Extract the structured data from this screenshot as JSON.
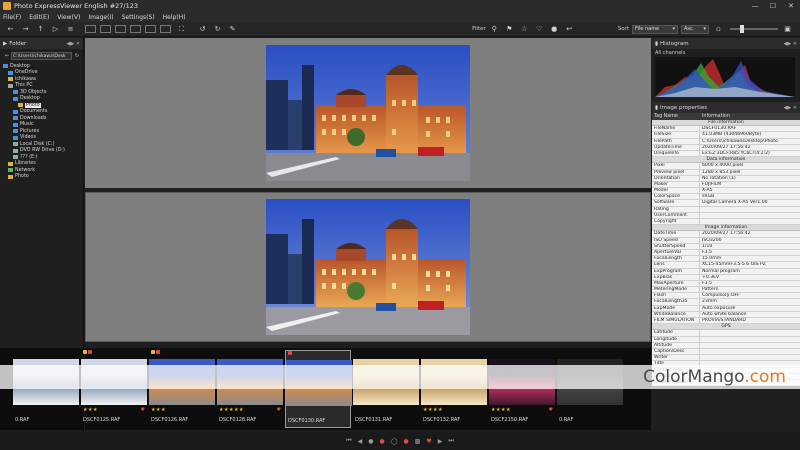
{
  "window": {
    "title": "Photo ExpressViewer English   #27/123",
    "minimize": "—",
    "maximize": "☐",
    "close": "✕"
  },
  "menu": [
    "File(F)",
    "Edit(E)",
    "View(V)",
    "Image(I)",
    "Settings(S)",
    "Help(H)"
  ],
  "toolbar": {
    "filter_label": "Filter",
    "sort_label": "Sort",
    "sort_field": "File name",
    "sort_order": "Asc."
  },
  "folder_panel": {
    "title": "Folder",
    "path": "C:\\Users\\ichikawa\\Desk",
    "tree": [
      {
        "label": "Desktop",
        "icon": "blue",
        "indent": 0
      },
      {
        "label": "OneDrive",
        "icon": "blue",
        "indent": 1
      },
      {
        "label": "ichikawa",
        "icon": "folder",
        "indent": 1
      },
      {
        "label": "This PC",
        "icon": "drive",
        "indent": 1
      },
      {
        "label": "3D Objects",
        "icon": "blue",
        "indent": 2
      },
      {
        "label": "Desktop",
        "icon": "blue",
        "indent": 2
      },
      {
        "label": "Photo",
        "icon": "folder",
        "indent": 3,
        "selected": true
      },
      {
        "label": "Documents",
        "icon": "blue",
        "indent": 2
      },
      {
        "label": "Downloads",
        "icon": "blue",
        "indent": 2
      },
      {
        "label": "Music",
        "icon": "blue",
        "indent": 2
      },
      {
        "label": "Pictures",
        "icon": "blue",
        "indent": 2
      },
      {
        "label": "Videos",
        "icon": "blue",
        "indent": 2
      },
      {
        "label": "Local Disk (C:)",
        "icon": "drive",
        "indent": 2
      },
      {
        "label": "DVD RW Drive (D:)",
        "icon": "drive",
        "indent": 2
      },
      {
        "label": "??? (E:)",
        "icon": "drive",
        "indent": 2
      },
      {
        "label": "Libraries",
        "icon": "folder",
        "indent": 1
      },
      {
        "label": "Network",
        "icon": "green",
        "indent": 1
      },
      {
        "label": "Photo",
        "icon": "folder",
        "indent": 1
      }
    ]
  },
  "histogram": {
    "title": "Histogram",
    "channel": "All channels"
  },
  "properties": {
    "title": "Image properties",
    "col_tag": "Tag Name",
    "col_info": "Information",
    "sections": [
      {
        "name": "File information",
        "rows": [
          [
            "FileName",
            "DSCF0130.RAF"
          ],
          [
            "FileSize",
            "41.03MB (43046960Byte)"
          ],
          [
            "FilePath",
            "C:\\Users\\ichikawa\\Desktop\\Photo"
          ],
          [
            "UpdateTime",
            "2020/09/27 17:56:42"
          ],
          [
            "UniqueInfo",
            "Ex:E2:3DCF:R85:YCbCr(4:2:2)"
          ]
        ]
      },
      {
        "name": "Data information",
        "rows": [
          [
            "Pixel",
            "6000 x 4000 pixel"
          ],
          [
            "Preview pixel",
            "1280 x 853 pixel"
          ],
          [
            "Orientation",
            "No rotation (1)"
          ],
          [
            "Maker",
            "FUJIFILM"
          ],
          [
            "Model",
            "X-A5"
          ],
          [
            "ColorSpace",
            "sRGB"
          ],
          [
            "Software",
            "Digital Camera X-A5 Ver1.00"
          ],
          [
            "Rating",
            ""
          ],
          [
            "UserComment",
            ""
          ],
          [
            "Copyright",
            ""
          ]
        ]
      },
      {
        "name": "Image information",
        "rows": [
          [
            "DateTime",
            "2020/09/27 17:56:42"
          ],
          [
            "ISO Speed",
            "ISO3200"
          ],
          [
            "ShutterSpeed",
            "1/10"
          ],
          [
            "ApertureVal",
            "F3.5"
          ],
          [
            "FocalLength",
            "15.0mm"
          ],
          [
            "Lens",
            "XC15-45mmF3.5-5.6 OIS PZ"
          ],
          [
            "ExpProgram",
            "Normal program"
          ],
          [
            "ExpBias",
            "+0.3EV"
          ],
          [
            "MaxAperture",
            "F3.5"
          ],
          [
            "MeteringMode",
            "Pattern"
          ],
          [
            "Flash",
            "Compulsory OFF"
          ],
          [
            "FocalLength35",
            "23mm"
          ],
          [
            "ExpMode",
            "Auto exposure"
          ],
          [
            "WhiteBalance",
            "Auto white balance"
          ],
          [
            "FILM SIMULATION",
            "PROVIA/STANDARD"
          ]
        ]
      },
      {
        "name": "GPS",
        "rows": [
          [
            "Latitude",
            ""
          ],
          [
            "Longitude",
            ""
          ],
          [
            "Altitude",
            ""
          ]
        ]
      },
      {
        "name": "",
        "rows": [
          [
            "Caption/Desc",
            ""
          ],
          [
            "Writer",
            ""
          ],
          [
            "Title",
            ""
          ],
          [
            "Contact info",
            ""
          ],
          [
            "Creator",
            ""
          ],
          [
            "Creator's Jobtit",
            ""
          ]
        ]
      }
    ]
  },
  "thumbnails": [
    {
      "name": "0.RAF",
      "stars": "",
      "heart": false,
      "badges": [],
      "style": "snow"
    },
    {
      "name": "DSCF0125.RAF",
      "stars": "★★★",
      "heart": true,
      "badges": [
        "y",
        "r"
      ],
      "style": "snow"
    },
    {
      "name": "DSCF0126.RAF",
      "stars": "★★★",
      "heart": false,
      "badges": [
        "y",
        "r"
      ],
      "style": "station"
    },
    {
      "name": "DSCF0128.RAF",
      "stars": "★★★★★",
      "heart": true,
      "badges": [],
      "style": "station"
    },
    {
      "name": "DSCF0130.RAF",
      "stars": "",
      "heart": false,
      "badges": [
        "r"
      ],
      "style": "station",
      "selected": true
    },
    {
      "name": "DSCF0131.RAF",
      "stars": "",
      "heart": false,
      "badges": [],
      "style": "lights"
    },
    {
      "name": "DSCF0132.RAF",
      "stars": "★★★★",
      "heart": false,
      "badges": [],
      "style": "lights"
    },
    {
      "name": "DSCF2150.RAF",
      "stars": "★★★★",
      "heart": true,
      "badges": [],
      "style": "night"
    },
    {
      "name": "0.RAF",
      "stars": "",
      "heart": false,
      "badges": [],
      "style": "dark"
    }
  ],
  "watermark": {
    "text_main": "ColorMango",
    "text_suffix": ".com"
  }
}
